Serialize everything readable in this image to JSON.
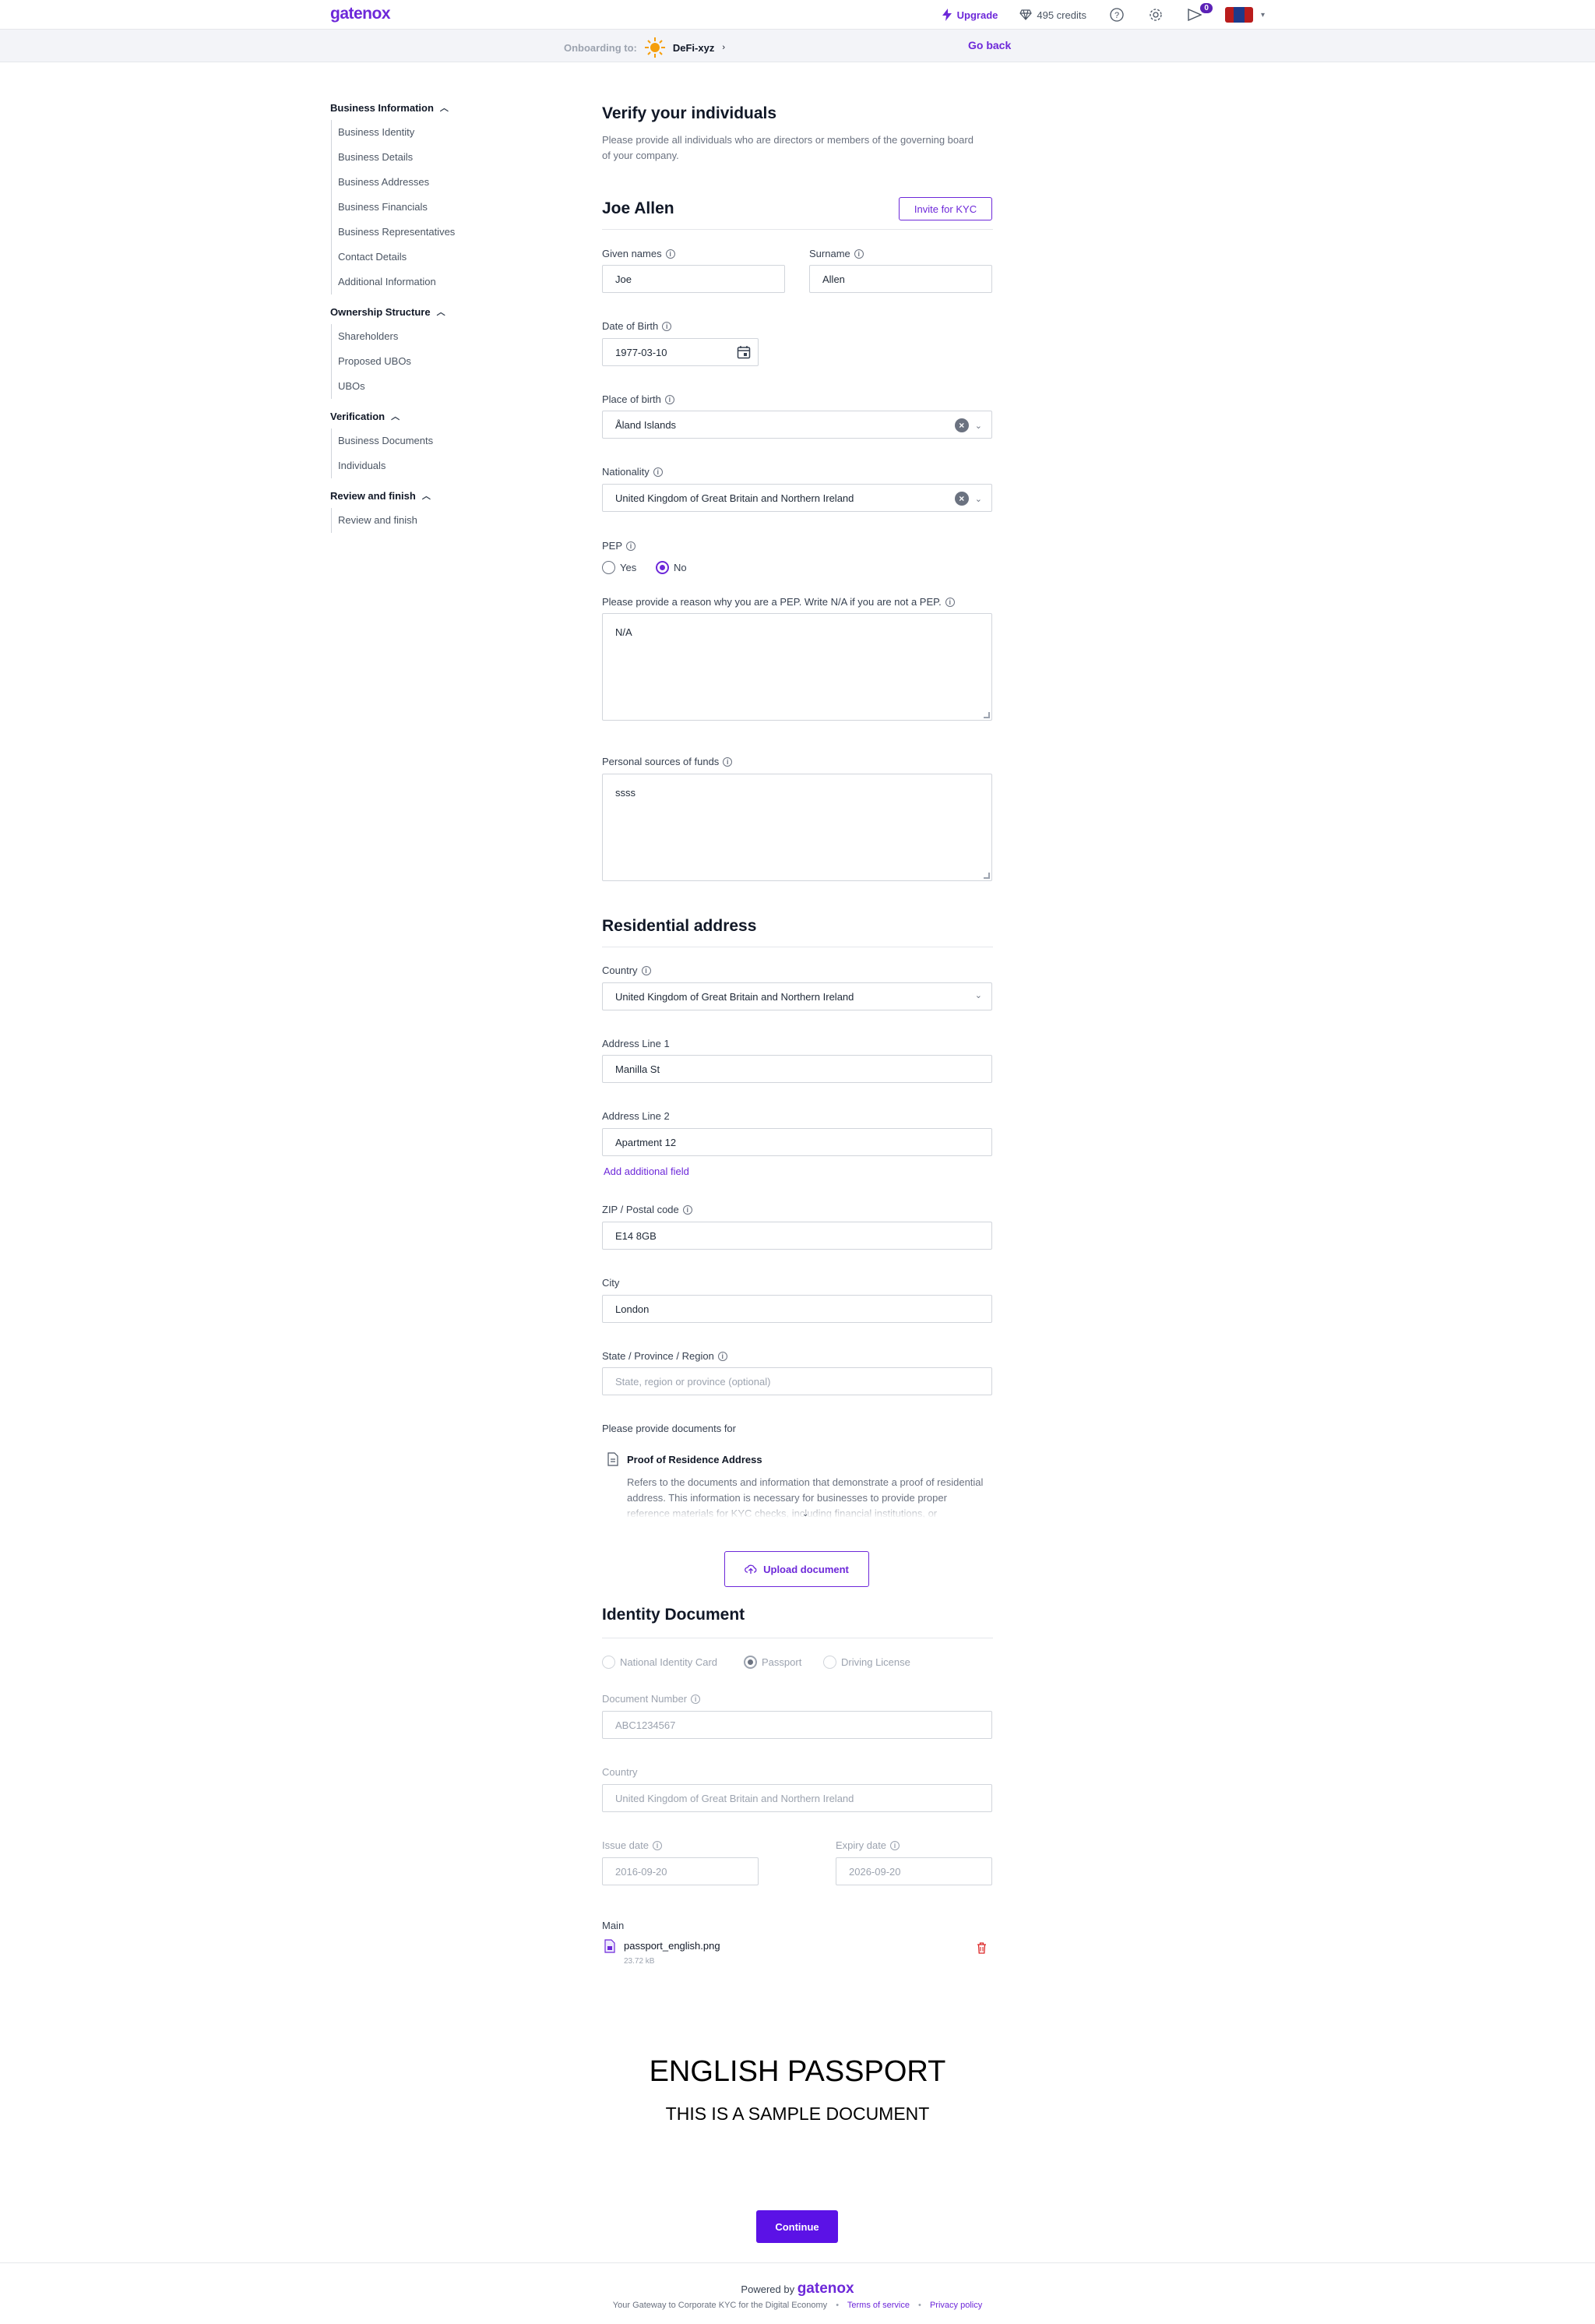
{
  "header": {
    "logo": "gatenox",
    "upgrade_label": "Upgrade",
    "credits_label": "495 credits",
    "notifications_count": "0"
  },
  "onboarding": {
    "label": "Onboarding to:",
    "company": "DeFi-xyz",
    "go_back": "Go back"
  },
  "nav": {
    "groups": [
      {
        "title": "Business Information",
        "items": [
          "Business Identity",
          "Business Details",
          "Business Addresses",
          "Business Financials",
          "Business Representatives",
          "Contact Details",
          "Additional Information"
        ]
      },
      {
        "title": "Ownership Structure",
        "items": [
          "Shareholders",
          "Proposed UBOs",
          "UBOs"
        ]
      },
      {
        "title": "Verification",
        "items": [
          "Business Documents",
          "Individuals"
        ]
      },
      {
        "title": "Review and finish",
        "items": [
          "Review and finish"
        ]
      }
    ]
  },
  "page": {
    "title": "Verify your individuals",
    "description": "Please provide all individuals who are directors or members of the governing board of your company."
  },
  "person": {
    "name": "Joe Allen",
    "invite_label": "Invite for KYC",
    "given_names_label": "Given names",
    "given_names_value": "Joe",
    "surname_label": "Surname",
    "surname_value": "Allen",
    "dob_label": "Date of Birth",
    "dob_value": "1977-03-10",
    "pob_label": "Place of birth",
    "pob_value": "Åland Islands",
    "nationality_label": "Nationality",
    "nationality_value": "United Kingdom of Great Britain and Northern Ireland",
    "pep_label": "PEP",
    "pep_yes": "Yes",
    "pep_no": "No",
    "pep_reason_label": "Please provide a reason why you are a PEP. Write N/A if you are not a PEP.",
    "pep_reason_value": "N/A",
    "funds_label": "Personal sources of funds",
    "funds_value": "ssss"
  },
  "address": {
    "title": "Residential address",
    "country_label": "Country",
    "country_value": "United Kingdom of Great Britain and Northern Ireland",
    "line1_label": "Address Line 1",
    "line1_value": "Manilla St",
    "line2_label": "Address Line 2",
    "line2_value": "Apartment 12",
    "add_field": "Add additional field",
    "zip_label": "ZIP / Postal code",
    "zip_value": "E14 8GB",
    "city_label": "City",
    "city_value": "London",
    "state_label": "State / Province / Region",
    "state_placeholder": "State, region or province (optional)",
    "docs_for": "Please provide documents for",
    "doc_title": "Proof of Residence Address",
    "doc_text": "Refers to the documents and information that demonstrate a proof of residential address. This information is necessary for businesses to provide proper reference materials for KYC checks, including financial institutions, or",
    "upload_label": "Upload document"
  },
  "identity": {
    "title": "Identity Document",
    "opt_national": "National Identity Card",
    "opt_passport": "Passport",
    "opt_driving": "Driving License",
    "doc_number_label": "Document Number",
    "doc_number_value": "ABC1234567",
    "country_label": "Country",
    "country_value": "United Kingdom of Great Britain and Northern Ireland",
    "issue_label": "Issue date",
    "issue_value": "2016-09-20",
    "expiry_label": "Expiry date",
    "expiry_value": "2026-09-20",
    "main_label": "Main",
    "file_name": "passport_english.png",
    "file_size": "23.72 kB"
  },
  "preview": {
    "title": "ENGLISH PASSPORT",
    "subtitle": "THIS IS A SAMPLE DOCUMENT"
  },
  "continue_label": "Continue",
  "footer": {
    "powered_by": "Powered by",
    "logo": "gatenox",
    "tagline": "Your Gateway to Corporate KYC for the Digital Economy",
    "terms": "Terms of service",
    "privacy": "Privacy policy"
  },
  "colors": {
    "accent": "#6d28d9",
    "primary_button": "#5b12e6"
  }
}
